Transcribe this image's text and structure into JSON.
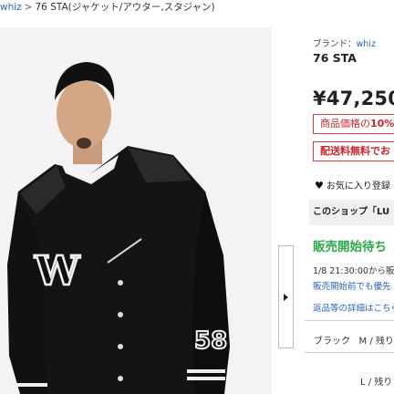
{
  "breadcrumb": {
    "brand": "whiz",
    "separator": ">",
    "current": "76 STA(ジャケット/アウター,スタジャン)"
  },
  "product": {
    "brand_label": "ブランド：",
    "brand_name": "whiz",
    "name": "76 STA",
    "price": "¥47,250",
    "badge_points_prefix": "商品価格の",
    "badge_points_value": "10%",
    "badge_shipping": "配送料無料でお",
    "favorite": "お気に入り登録",
    "shop_notice": "このショップ「LU",
    "sale_status": "販売開始待ち",
    "sale_time": "1/8 21:30:00から販",
    "sale_priority": "販売開始前でも優先",
    "returns_link": "返品等の詳細はこちら"
  },
  "variants": [
    {
      "color": "ブラック",
      "size": "M / 残り"
    },
    {
      "color": "",
      "size": "L / 残り"
    }
  ],
  "photo": {
    "jacket_letter": "W",
    "sleeve_number": "58"
  },
  "colors": {
    "link": "#2a62b8",
    "badge_red": "#c9252d",
    "sale_green": "#2aa84a"
  },
  "icons": [
    "heart-icon",
    "next-image-arrow-icon"
  ]
}
